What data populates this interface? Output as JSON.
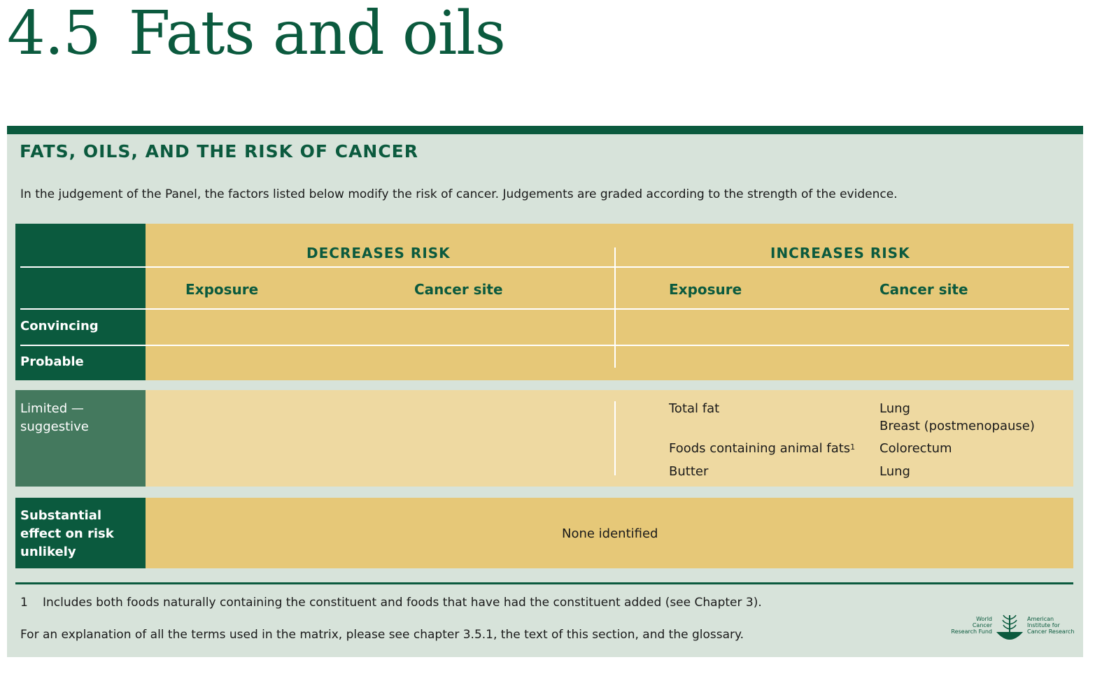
{
  "chapter": {
    "number": "4.5",
    "title": "Fats and oils"
  },
  "box": {
    "title": "FATS, OILS, AND THE RISK OF CANCER",
    "intro": "In the judgement of the Panel, the factors listed below modify the risk of cancer. Judgements are graded according to the strength of the evidence."
  },
  "matrix": {
    "decreases_header": "DECREASES RISK",
    "increases_header": "INCREASES RISK",
    "col_exposure": "Exposure",
    "col_cancer_site": "Cancer site",
    "rows": {
      "convincing": "Convincing",
      "probable": "Probable",
      "limited_line1": "Limited —",
      "limited_line2": "suggestive",
      "substantial_line1": "Substantial",
      "substantial_line2": "effect on risk",
      "substantial_line3": "unlikely"
    },
    "limited_increases": [
      {
        "exposure": "Total fat",
        "site_line1": "Lung",
        "site_line2": "Breast (postmenopause)"
      },
      {
        "exposure": "Foods containing animal fats",
        "exposure_sup": "1",
        "site_line1": "Colorectum"
      },
      {
        "exposure": "Butter",
        "site_line1": "Lung"
      }
    ],
    "substantial_value": "None identified"
  },
  "footnotes": {
    "fn1_number": "1",
    "fn1_text": "Includes both foods naturally containing the constituent and foods that have had the constituent added (see Chapter 3).",
    "explanation": "For an explanation of all the terms used in the matrix, please see chapter 3.5.1, the text of this section, and the glossary."
  },
  "logo": {
    "left_line1": "World",
    "left_line2": "Cancer",
    "left_line3": "Research Fund",
    "right_line1": "American",
    "right_line2": "Institute for",
    "right_line3": "Cancer Research"
  },
  "colors": {
    "brand_green": "#0b5a3e",
    "panel_bg": "#d7e3da",
    "ochre": "#e6c878",
    "ochre_light": "#eed9a1",
    "limited_green": "#44795e"
  }
}
